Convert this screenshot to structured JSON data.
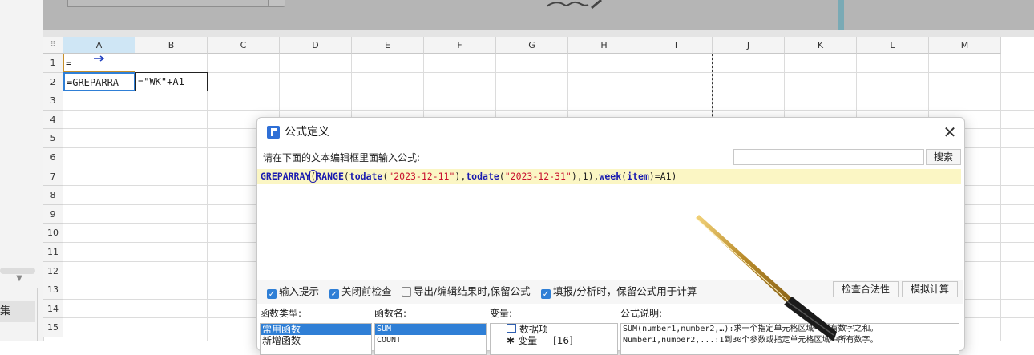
{
  "left_panel": {
    "tab_label": "集",
    "chevron": "▼"
  },
  "sheet": {
    "columns": [
      "A",
      "B",
      "C",
      "D",
      "E",
      "F",
      "G",
      "H",
      "I",
      "J",
      "K",
      "L",
      "M"
    ],
    "rows": [
      "1",
      "2",
      "3",
      "4",
      "5",
      "6",
      "7",
      "8",
      "9",
      "10",
      "11",
      "12",
      "13",
      "14",
      "15"
    ],
    "cells": {
      "A1": "=",
      "A2": "=GREPARRA",
      "B2": "=\"WK\"+A1"
    },
    "corner_glyph": "⠿"
  },
  "dialog": {
    "title": "公式定义",
    "close_glyph": "✕",
    "prompt_label": "请在下面的文本编辑框里面输入公式:",
    "search_button": "搜索",
    "search_value": "",
    "formula": {
      "fn1": "GREPARRAY",
      "p1": "(",
      "fn2": "RANGE",
      "p2": "(",
      "fn3": "todate",
      "p3": "(",
      "s1": "\"2023-12-11\"",
      "p4": "),",
      "fn4": "todate",
      "p5": "(",
      "s2": "\"2023-12-31\"",
      "p6": "),1),",
      "fn5": "week",
      "p7": "(",
      "fn6": "item",
      "p8": ")=A1)"
    },
    "options": [
      {
        "label": "输入提示",
        "checked": true
      },
      {
        "label": "关闭前检查",
        "checked": true
      },
      {
        "label": "导出/编辑结果时,保留公式",
        "checked": false
      },
      {
        "label": "填报/分析时，保留公式用于计算",
        "checked": true
      }
    ],
    "check_button": "检查合法性",
    "simulate_button": "模拟计算",
    "panes": {
      "function_type_label": "函数类型:",
      "function_type_items": [
        "常用函数",
        "新增函数"
      ],
      "function_name_label": "函数名:",
      "function_name_items": [
        "SUM",
        "COUNT"
      ],
      "variable_label": "变量:",
      "variable_items": [
        "数据项",
        "变量",
        "[16]"
      ],
      "description_label": "公式说明:",
      "description_text": "SUM(number1,number2,…):求一个指定单元格区域中所有数字之和。",
      "description_text2": "Number1,number2,...:1到30个参数或指定单元格区域中所有数字。"
    }
  },
  "colors": {
    "accent": "#2f7fd6",
    "formula_bg": "#fbf6c4",
    "fn_color": "#1a1ab0",
    "str_color": "#c8102e",
    "selected_col": "#cfe6f5"
  }
}
